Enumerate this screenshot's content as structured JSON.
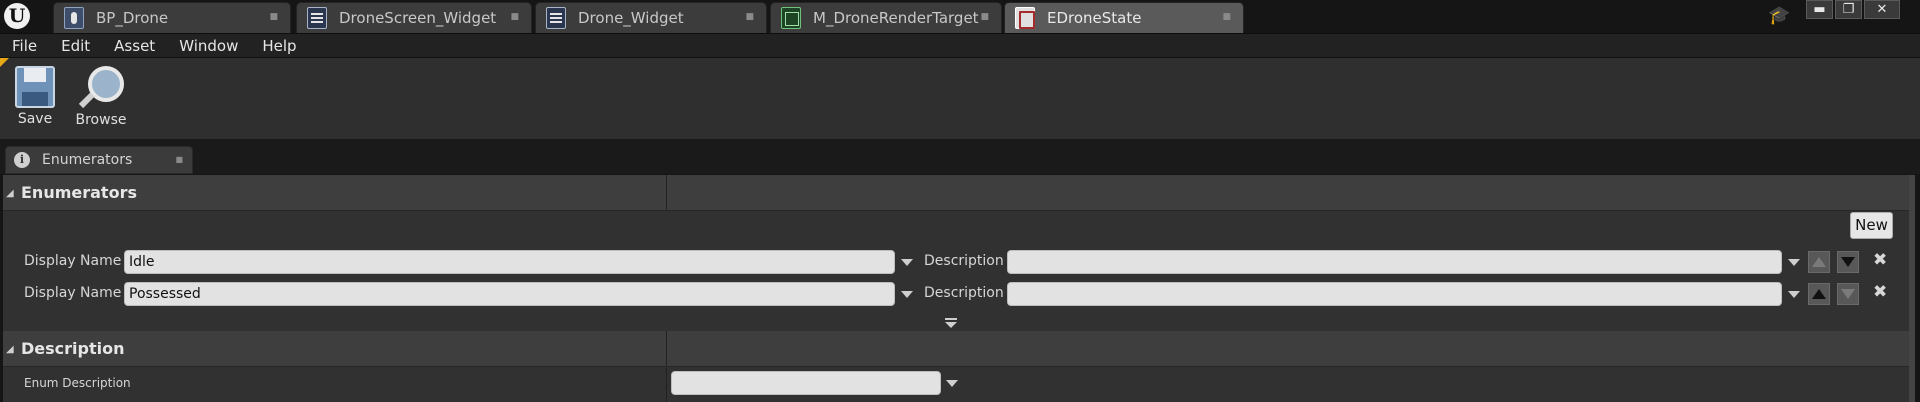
{
  "tabs": [
    {
      "label": "BP_Drone",
      "icon": "blueprint-icon"
    },
    {
      "label": "DroneScreen_Widget",
      "icon": "widget-icon"
    },
    {
      "label": "Drone_Widget",
      "icon": "widget-icon"
    },
    {
      "label": "M_DroneRenderTarget",
      "icon": "material-icon"
    },
    {
      "label": "EDroneState",
      "icon": "enum-icon",
      "active": true
    }
  ],
  "engine_logo": "U",
  "menu": [
    "File",
    "Edit",
    "Asset",
    "Window",
    "Help"
  ],
  "toolbar": {
    "save_label": "Save",
    "browse_label": "Browse"
  },
  "panel": {
    "tab_label": "Enumerators"
  },
  "enumerators_section": {
    "title": "Enumerators",
    "new_button": "New",
    "display_name_label": "Display Name",
    "description_label": "Description",
    "rows": [
      {
        "display_name": "Idle",
        "description": "",
        "up_enabled": false,
        "down_enabled": true
      },
      {
        "display_name": "Possessed",
        "description": "",
        "up_enabled": true,
        "down_enabled": false
      }
    ]
  },
  "description_section": {
    "title": "Description",
    "enum_description_label": "Enum Description",
    "enum_description_value": ""
  },
  "colors": {
    "accent_corner": "#e6a817",
    "active_tab": "#5a5a5a",
    "field_bg": "#e2e2e2"
  }
}
